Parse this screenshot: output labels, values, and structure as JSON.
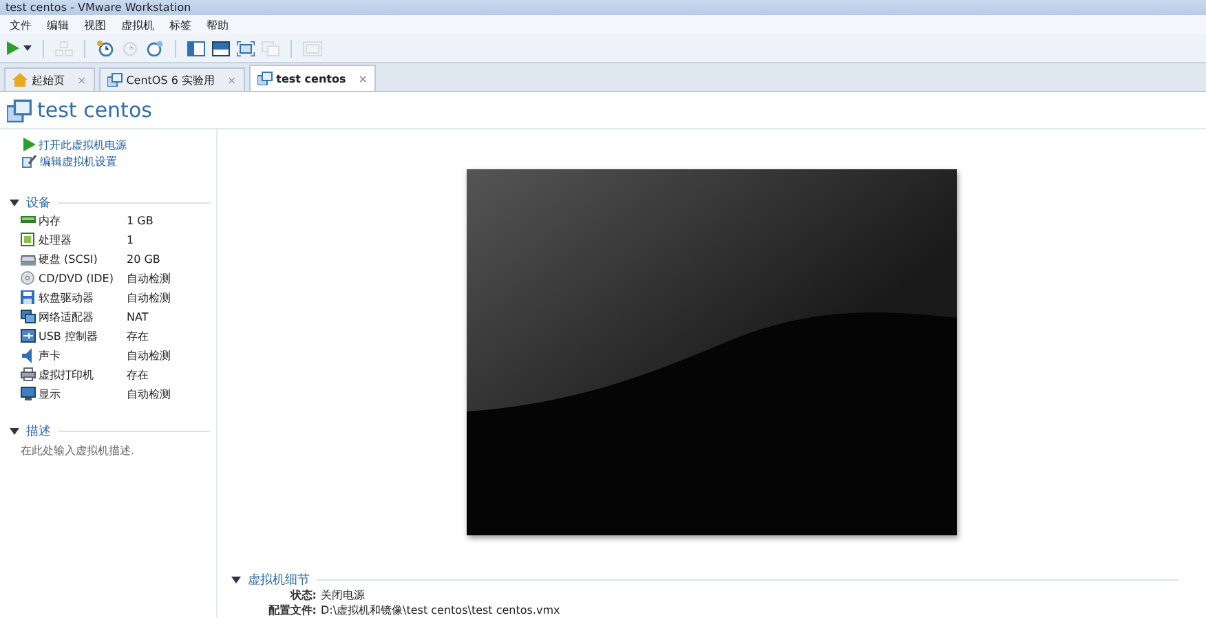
{
  "window": {
    "title": "test centos - VMware Workstation"
  },
  "menu": [
    "文件",
    "编辑",
    "视图",
    "虚拟机",
    "标签",
    "帮助"
  ],
  "toolbar": [
    {
      "kind": "play"
    },
    {
      "kind": "caret"
    },
    {
      "kind": "sep"
    },
    {
      "kind": "net",
      "disabled": true
    },
    {
      "kind": "sep"
    },
    {
      "kind": "snap",
      "disabled": false
    },
    {
      "kind": "revert",
      "disabled": true
    },
    {
      "kind": "manage",
      "disabled": false
    },
    {
      "kind": "sep"
    },
    {
      "kind": "sidebar",
      "disabled": false
    },
    {
      "kind": "thumb",
      "disabled": false
    },
    {
      "kind": "full",
      "disabled": false
    },
    {
      "kind": "unity",
      "disabled": true
    },
    {
      "kind": "sep"
    },
    {
      "kind": "console",
      "disabled": true
    }
  ],
  "tabs": [
    {
      "label": "起始页",
      "kind": "home",
      "close": "×",
      "selected": false
    },
    {
      "label": "CentOS 6 实验用",
      "kind": "vm",
      "close": "×",
      "selected": false
    },
    {
      "label": "test centos",
      "kind": "vm",
      "close": "×",
      "selected": true
    }
  ],
  "vm_title": "test centos",
  "actions": [
    {
      "label": "打开此虚拟机电源",
      "kind": "play"
    },
    {
      "label": "编辑虚拟机设置",
      "kind": "edit"
    }
  ],
  "devices": {
    "title": "设备",
    "expanded": true,
    "items": [
      {
        "name": "内存",
        "value": "1 GB",
        "kind": "memory"
      },
      {
        "name": "处理器",
        "value": "1",
        "kind": "cpu"
      },
      {
        "name": "硬盘 (SCSI)",
        "value": "20 GB",
        "kind": "disk"
      },
      {
        "name": "CD/DVD (IDE)",
        "value": "自动检测",
        "kind": "cd"
      },
      {
        "name": "软盘驱动器",
        "value": "自动检测",
        "kind": "floppy"
      },
      {
        "name": "网络适配器",
        "value": "NAT",
        "kind": "network"
      },
      {
        "name": "USB 控制器",
        "value": "存在",
        "kind": "usb"
      },
      {
        "name": "声卡",
        "value": "自动检测",
        "kind": "sound"
      },
      {
        "name": "虚拟打印机",
        "value": "存在",
        "kind": "printer"
      },
      {
        "name": "显示",
        "value": "自动检测",
        "kind": "display"
      }
    ]
  },
  "description": {
    "title": "描述",
    "expanded": true,
    "placeholder": "在此处输入虚拟机描述."
  },
  "details": {
    "title": "虚拟机细节",
    "expanded": true,
    "rows": [
      {
        "label": "状态:",
        "value": "关闭电源"
      },
      {
        "label": "配置文件:",
        "value": "D:\\虚拟机和镜像\\test centos\\test centos.vmx"
      }
    ]
  }
}
